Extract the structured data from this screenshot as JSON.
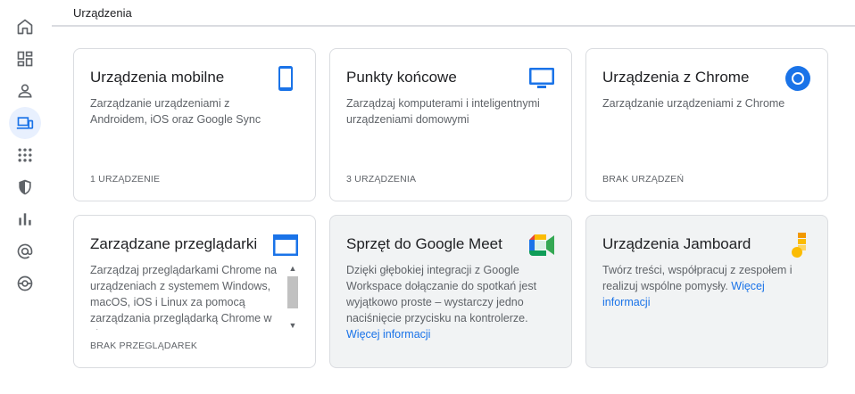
{
  "header": {
    "title": "Urządzenia"
  },
  "rail": {
    "items": [
      {
        "icon": "home-icon",
        "active": false
      },
      {
        "icon": "dashboard-icon",
        "active": false
      },
      {
        "icon": "user-icon",
        "active": false
      },
      {
        "icon": "devices-icon",
        "active": true
      },
      {
        "icon": "apps-grid-icon",
        "active": false
      },
      {
        "icon": "security-shield-icon",
        "active": false
      },
      {
        "icon": "reports-bar-chart-icon",
        "active": false
      },
      {
        "icon": "at-sign-icon",
        "active": false
      },
      {
        "icon": "support-lifebuoy-icon",
        "active": false
      }
    ]
  },
  "cards": {
    "mobile": {
      "title": "Urządzenia mobilne",
      "desc": "Zarządzanie urządzeniami z Androidem, iOS oraz Google Sync",
      "footer": "1 URZĄDZENIE",
      "icon": "smartphone-icon"
    },
    "endpoints": {
      "title": "Punkty końcowe",
      "desc": "Zarządzaj komputerami i inteligentnymi urządzeniami domowymi",
      "footer": "3 URZĄDZENIA",
      "icon": "monitor-icon"
    },
    "chrome": {
      "title": "Urządzenia z Chrome",
      "desc": "Zarządzanie urządzeniami z Chrome",
      "footer": "BRAK URZĄDZEŃ",
      "icon": "chrome-icon"
    },
    "browsers": {
      "title": "Zarządzane przeglądarki",
      "desc": "Zarządzaj przeglądarkami Chrome na urządzeniach z systemem Windows, macOS, iOS i Linux za pomocą zarządzania przeglądarką Chrome w chmurze",
      "footer": "BRAK PRZEGLĄDAREK",
      "icon": "browser-window-icon"
    },
    "meet": {
      "title": "Sprzęt do Google Meet",
      "desc": "Dzięki głębokiej integracji z Google Workspace dołączanie do spotkań jest wyjątkowo proste – wystarczy jedno naciśnięcie przycisku na kontrolerze.",
      "link": "Więcej informacji",
      "icon": "google-meet-icon"
    },
    "jamboard": {
      "title": "Urządzenia Jamboard",
      "desc": "Twórz treści, współpracuj z zespołem i realizuj wspólne pomysły.",
      "link": "Więcej informacji",
      "icon": "jamboard-icon"
    }
  },
  "scrollbar": {
    "up": "▲",
    "down": "▼"
  },
  "colors": {
    "accent": "#1a73e8",
    "active_bg": "#e8f0fe",
    "grey_card": "#f1f3f4"
  }
}
